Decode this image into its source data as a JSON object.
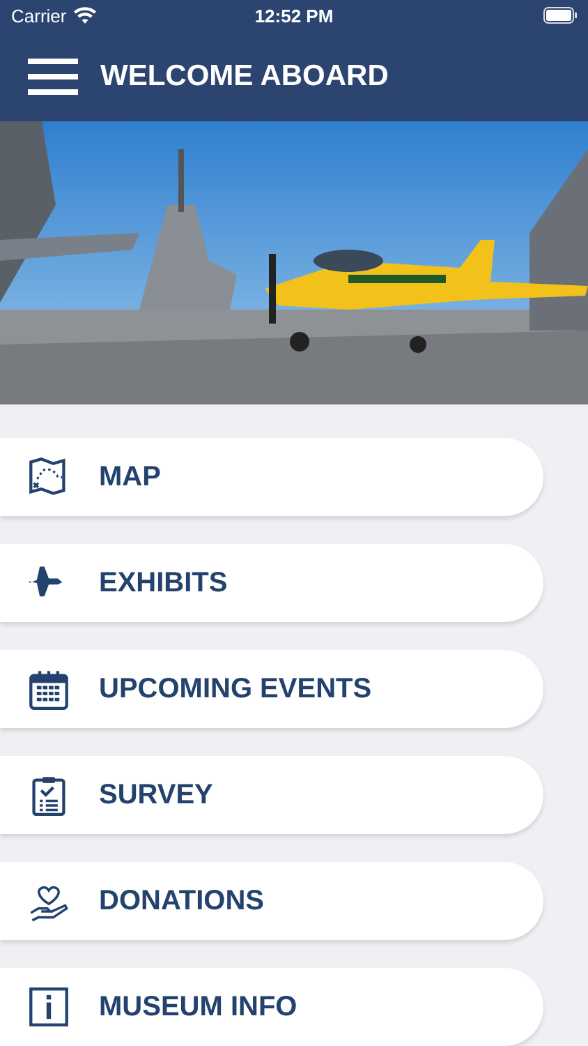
{
  "status_bar": {
    "carrier": "Carrier",
    "time": "12:52 PM"
  },
  "header": {
    "title": "WELCOME ABOARD"
  },
  "menu": [
    {
      "label": "MAP"
    },
    {
      "label": "EXHIBITS"
    },
    {
      "label": "UPCOMING EVENTS"
    },
    {
      "label": "SURVEY"
    },
    {
      "label": "DONATIONS"
    },
    {
      "label": "MUSEUM INFO"
    }
  ]
}
